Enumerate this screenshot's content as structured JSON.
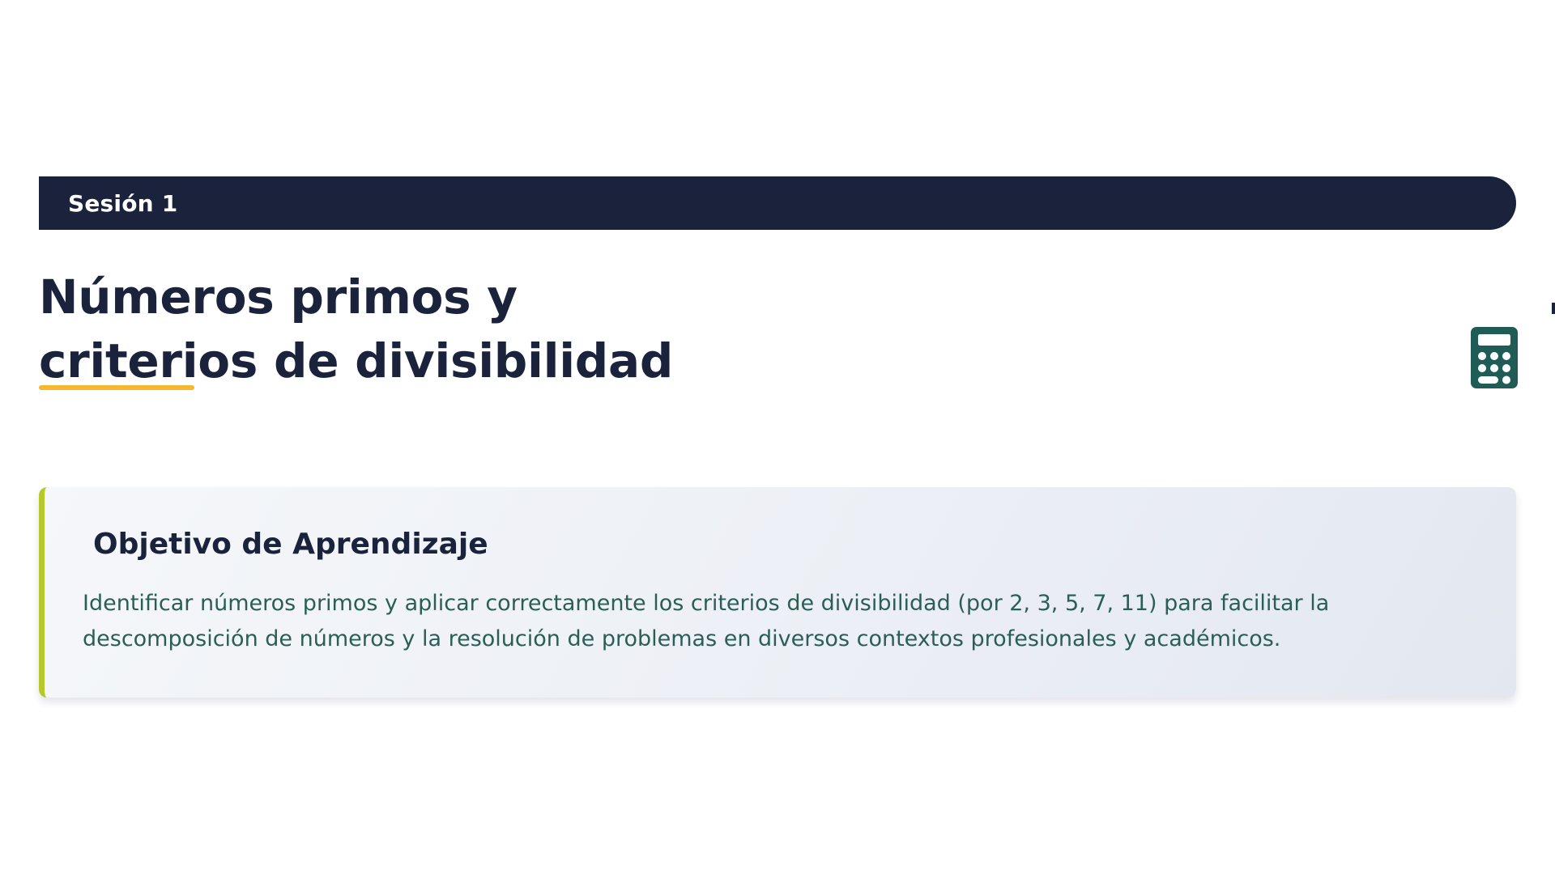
{
  "session": {
    "label": "Sesión 1"
  },
  "title": {
    "line1": "Números primos y",
    "line2": "criterios de divisibilidad"
  },
  "icons": {
    "calculator": "calculator-icon"
  },
  "objective": {
    "heading": "Objetivo de Aprendizaje",
    "text": "Identificar números primos y aplicar correctamente los criterios de divisibilidad (por 2, 3, 5, 7, 11) para facilitar la descomposición de números y la resolución de problemas en diversos contextos profesionales y académicos."
  },
  "colors": {
    "navy": "#1a233b",
    "accent_yellow": "#f5b82e",
    "accent_green": "#b7c92a",
    "teal_icon": "#1f5c55",
    "body_teal": "#2a5f56"
  }
}
